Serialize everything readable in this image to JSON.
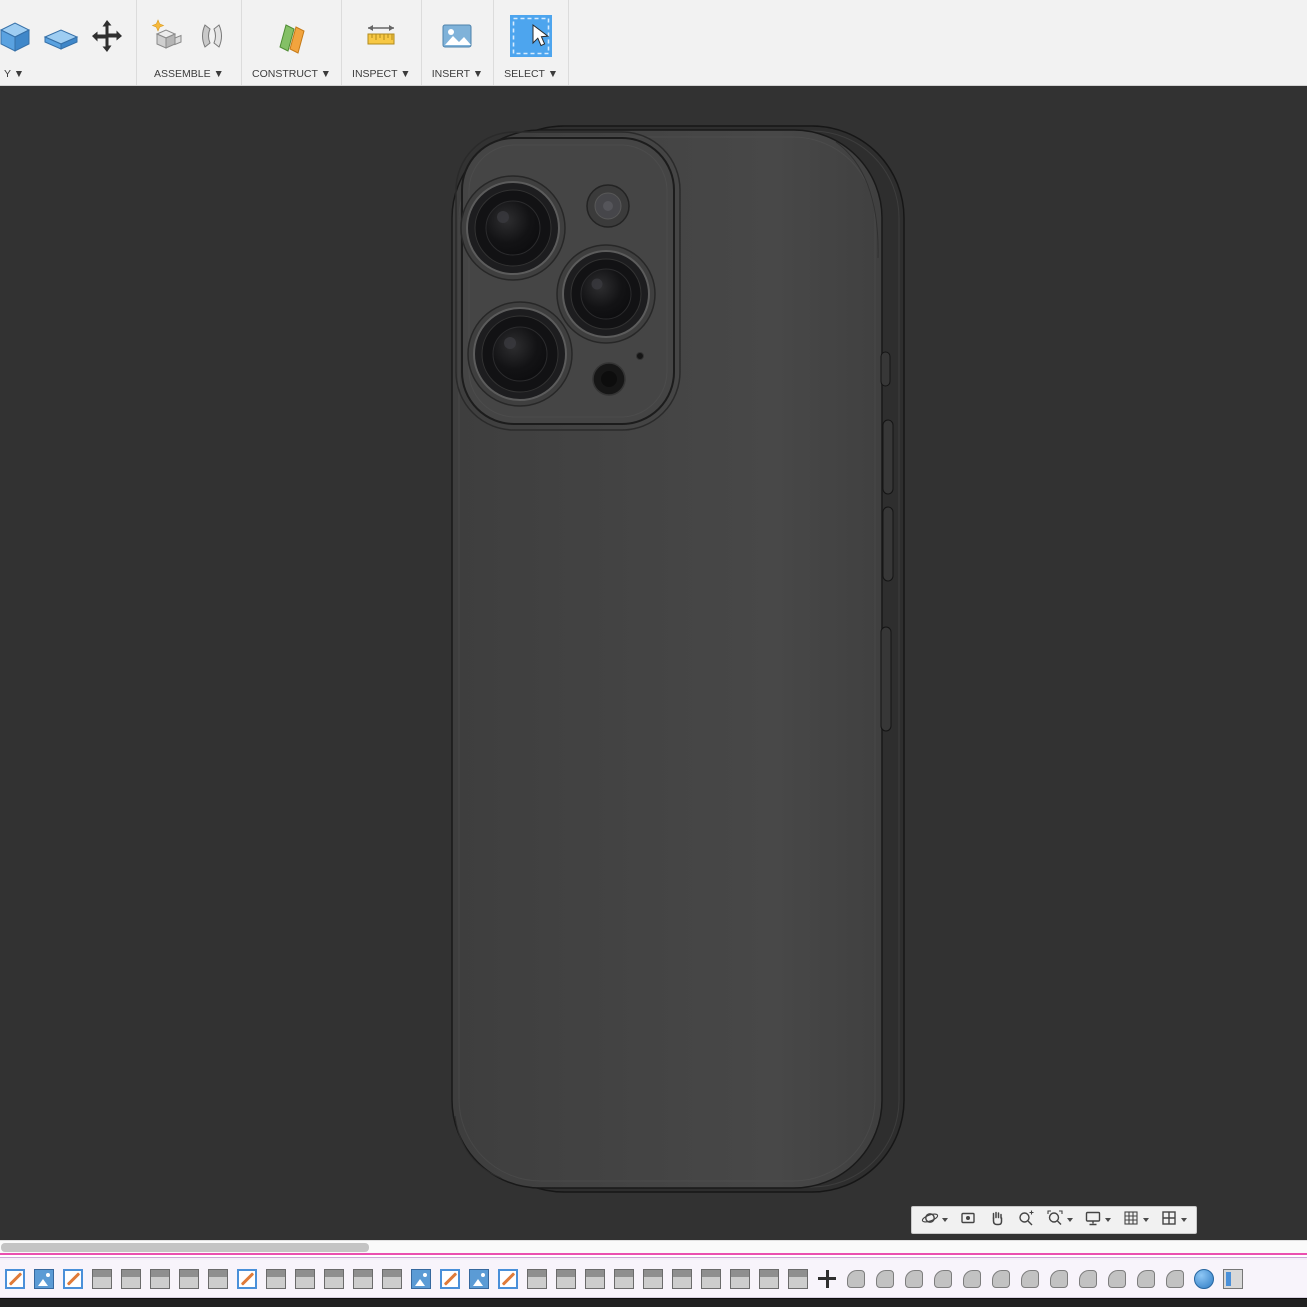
{
  "colors": {
    "accent_blue": "#4da5ee",
    "toolbar_bg": "#f2f2f2",
    "viewport_bg": "#323232",
    "timeline_stripe_pink": "#ea4fb0",
    "timeline_bg": "#f8f4fb"
  },
  "toolbar": {
    "groups": [
      {
        "label": "Y ▼",
        "icons": [
          "press-pull-icon",
          "shell-icon",
          "move-icon"
        ]
      },
      {
        "label": "ASSEMBLE ▼",
        "icons": [
          "new-component-icon",
          "joint-icon"
        ]
      },
      {
        "label": "CONSTRUCT ▼",
        "icons": [
          "construction-plane-icon"
        ]
      },
      {
        "label": "INSPECT ▼",
        "icons": [
          "measure-icon"
        ]
      },
      {
        "label": "INSERT ▼",
        "icons": [
          "canvas-icon"
        ]
      },
      {
        "label": "SELECT ▼",
        "icons": [
          "select-icon"
        ]
      }
    ]
  },
  "navbar": {
    "icons": [
      {
        "name": "orbit-icon",
        "caret": true
      },
      {
        "name": "look-at-icon",
        "caret": false
      },
      {
        "name": "pan-icon",
        "caret": false
      },
      {
        "name": "zoom-icon",
        "caret": false
      },
      {
        "name": "fit-icon",
        "caret": true
      },
      {
        "name": "display-settings-icon",
        "caret": true
      },
      {
        "name": "grid-display-icon",
        "caret": true
      },
      {
        "name": "viewports-icon",
        "caret": true
      }
    ]
  },
  "timeline": {
    "items": [
      "sketch",
      "canvas",
      "sketch",
      "extrude",
      "extrude",
      "extrude",
      "extrude",
      "extrude",
      "sketch",
      "extrude",
      "extrude",
      "extrude",
      "extrude",
      "extrude",
      "canvas",
      "sketch",
      "canvas",
      "sketch",
      "extrude",
      "extrude",
      "extrude",
      "extrude",
      "extrude",
      "extrude",
      "extrude",
      "extrude",
      "extrude",
      "extrude",
      "move",
      "fillet",
      "fillet",
      "fillet",
      "fillet",
      "fillet",
      "fillet",
      "fillet",
      "fillet",
      "fillet",
      "fillet",
      "fillet",
      "fillet",
      "sphere",
      "form"
    ]
  }
}
